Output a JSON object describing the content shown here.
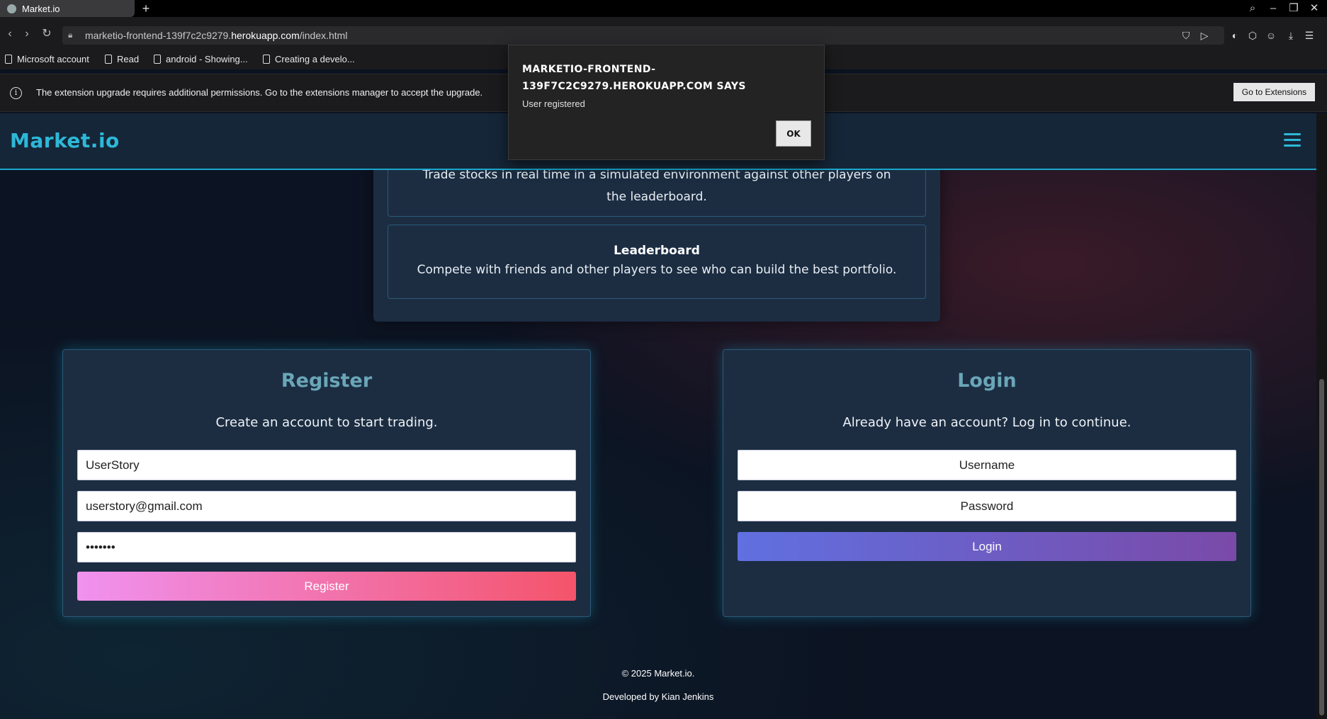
{
  "browser": {
    "tab_title": "Market.io",
    "new_tab": "+",
    "url_prefix": "marketio-frontend-139f7c2c9279.",
    "url_domain": "herokuapp.com",
    "url_path": "/index.html",
    "bookmarks": [
      "Microsoft account",
      "Read",
      "android - Showing...",
      "Creating a develo..."
    ],
    "infobar_text": "The extension upgrade requires additional permissions. Go to the extensions manager to accept the upgrade.",
    "infobar_button": "Go to Extensions"
  },
  "site": {
    "logo": "Market.io",
    "features": [
      {
        "title": "",
        "description": "Trade stocks in real time in a simulated environment against other players on the leaderboard."
      },
      {
        "title": "Leaderboard",
        "description": "Compete with friends and other players to see who can build the best portfolio."
      }
    ],
    "register": {
      "title": "Register",
      "subtitle": "Create an account to start trading.",
      "username_value": "UserStory",
      "email_value": "userstory@gmail.com",
      "password_value": "•••••••",
      "button": "Register"
    },
    "login": {
      "title": "Login",
      "subtitle": "Already have an account? Log in to continue.",
      "username_placeholder": "Username",
      "password_placeholder": "Password",
      "button": "Login"
    },
    "footer": {
      "copyright": "© 2025 Market.io.",
      "developer": "Developed by Kian Jenkins"
    }
  },
  "dialog": {
    "title": "MARKETIO-FRONTEND-139F7C2C9279.HEROKUAPP.COM SAYS",
    "message": "User registered",
    "ok": "OK"
  },
  "colors": {
    "accent": "#2eb8d8",
    "panel": "#1c2d42",
    "register_gradient": [
      "#f092f0",
      "#f4546a"
    ],
    "login_gradient": [
      "#6070e0",
      "#7a4aa8"
    ]
  }
}
